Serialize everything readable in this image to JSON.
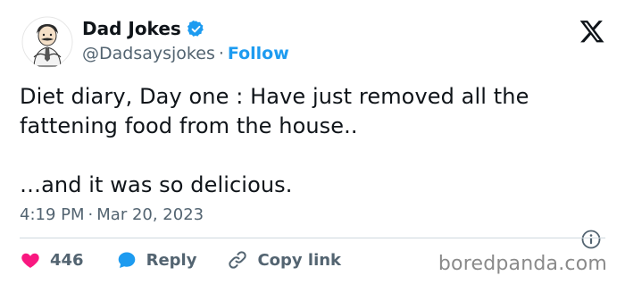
{
  "author": {
    "name": "Dad Jokes",
    "handle": "@Dadsaysjokes",
    "separator": "·",
    "follow_label": "Follow"
  },
  "post": {
    "line1": "Diet diary, Day one : Have just removed all the",
    "line2": "fattening food from the house..",
    "line3": "…and it was so delicious.",
    "time": "4:19 PM",
    "separator": "·",
    "date": "Mar 20, 2023"
  },
  "actions": {
    "like_count": "446",
    "reply_label": "Reply",
    "copy_label": "Copy link"
  },
  "watermark": "boredpanda.com",
  "colors": {
    "accent": "#1d9bf0",
    "like": "#f91880",
    "muted": "#536471"
  },
  "icons": [
    "x-logo-icon",
    "verified-badge-icon",
    "heart-icon",
    "reply-bubble-icon",
    "link-icon",
    "info-icon"
  ]
}
